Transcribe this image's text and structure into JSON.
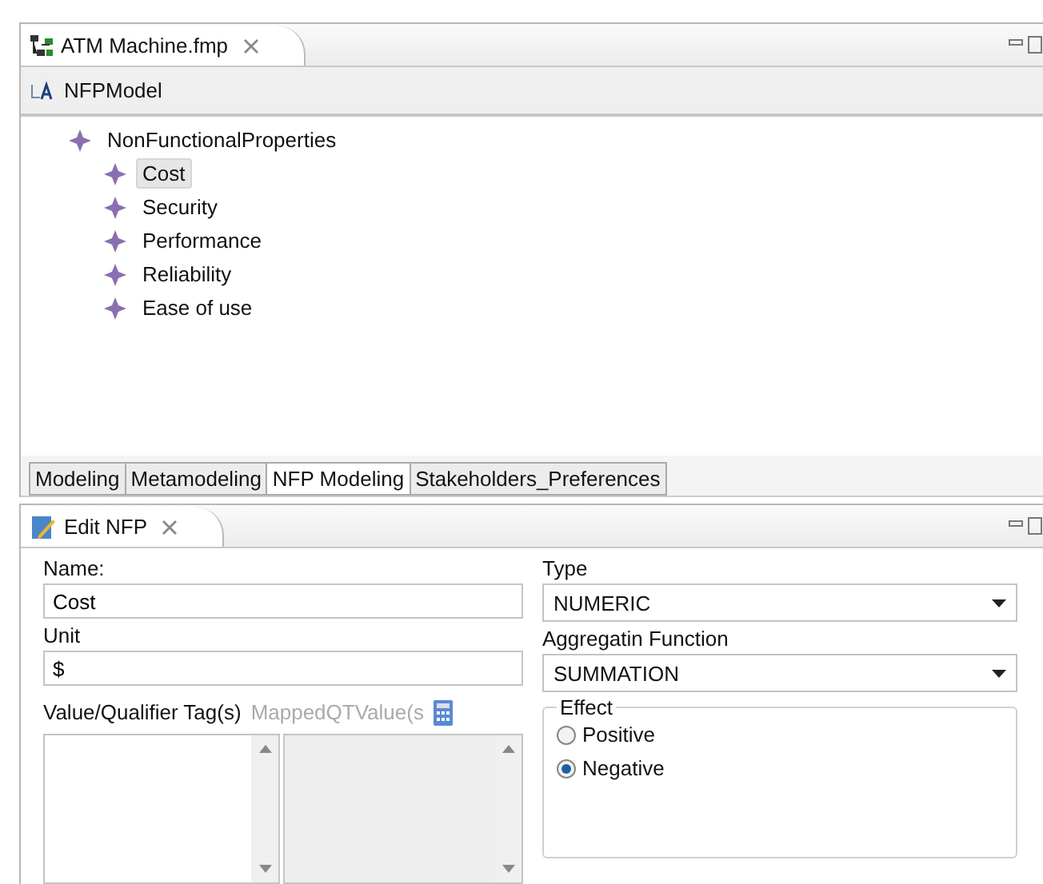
{
  "editor": {
    "tab": {
      "title": "ATM Machine.fmp"
    },
    "header": "NFPModel",
    "tree": [
      {
        "label": "NonFunctionalProperties",
        "selected": false,
        "children": [
          {
            "label": "Cost",
            "selected": true
          },
          {
            "label": "Security",
            "selected": false
          },
          {
            "label": "Performance",
            "selected": false
          },
          {
            "label": "Reliability",
            "selected": false
          },
          {
            "label": "Ease of use",
            "selected": false
          }
        ]
      }
    ],
    "page_tabs": [
      {
        "label": "Modeling",
        "selected": false
      },
      {
        "label": "Metamodeling",
        "selected": false
      },
      {
        "label": "NFP Modeling",
        "selected": true
      },
      {
        "label": "Stakeholders_Preferences",
        "selected": false
      }
    ]
  },
  "view": {
    "tab": {
      "title": "Edit NFP"
    },
    "name": {
      "label": "Name:",
      "value": "Cost"
    },
    "type": {
      "label": "Type",
      "value": "NUMERIC"
    },
    "unit": {
      "label": "Unit",
      "value": "$"
    },
    "aggregation": {
      "label": "Aggregatin Function",
      "value": "SUMMATION"
    },
    "tags": {
      "label": "Value/Qualifier Tag(s)",
      "mapped_label": "MappedQTValue(s",
      "mapped_disabled": true
    },
    "effect": {
      "label": "Effect",
      "options": [
        {
          "label": "Positive",
          "selected": false
        },
        {
          "label": "Negative",
          "selected": true
        }
      ]
    }
  }
}
